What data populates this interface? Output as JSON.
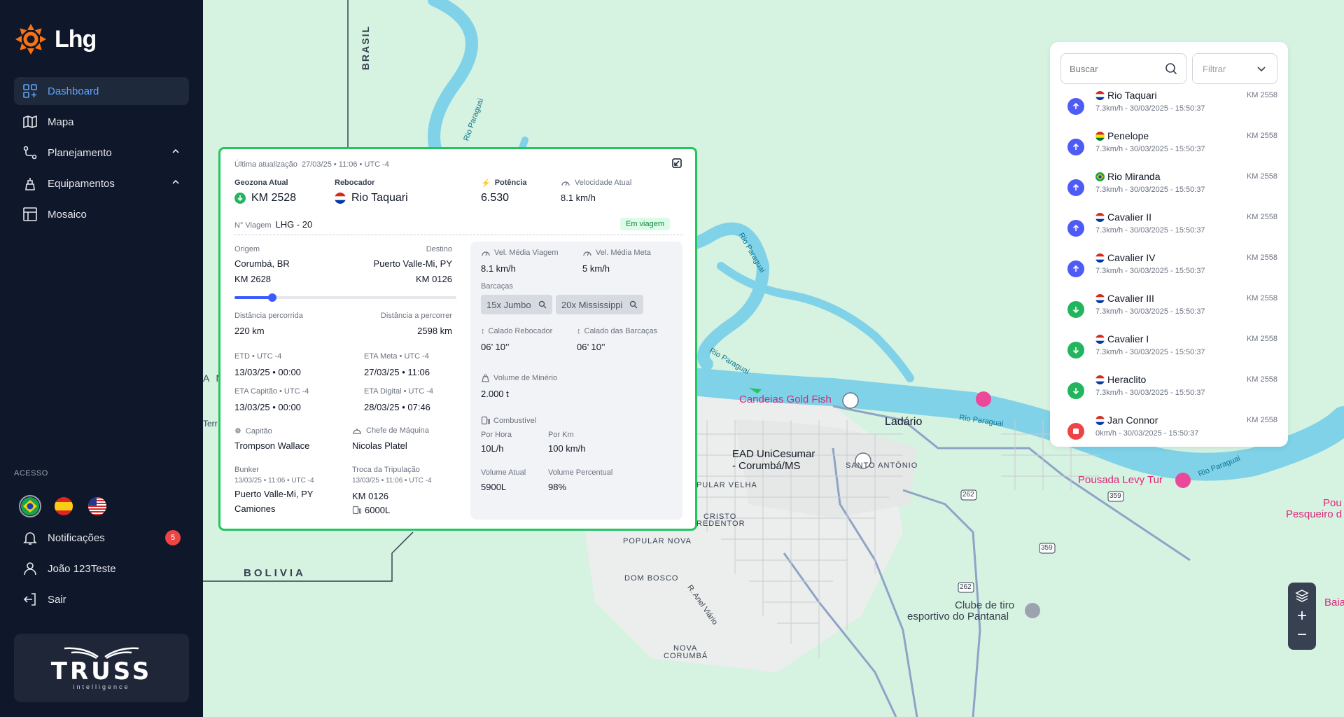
{
  "sidebar": {
    "logo_text": "Lhg",
    "nav": [
      {
        "label": "Dashboard",
        "icon": "dashboard-icon",
        "active": true
      },
      {
        "label": "Mapa",
        "icon": "map-icon"
      },
      {
        "label": "Planejamento",
        "icon": "route-icon"
      },
      {
        "label": "Equipamentos",
        "icon": "equipment-icon"
      },
      {
        "label": "Mosaico",
        "icon": "mosaic-icon"
      }
    ],
    "access_label": "ACESSO",
    "notifications_label": "Notificações",
    "notifications_count": "5",
    "user_label": "João 123Teste",
    "logout_label": "Sair",
    "brand_name": "TRUSS",
    "brand_sub": "intelligence"
  },
  "map": {
    "labels": {
      "brasil": "BRASIL",
      "bolivia": "BOLIVIA",
      "rio_paraguai": "Rio Paraguai",
      "candeias": "Candeias Gold Fish",
      "ladario": "Ladário",
      "ead_1": "EAD UniCesumar",
      "ead_2": "- Corumbá/MS",
      "santo_antonio": "SANTO ANTÔNIO",
      "popular_velha": "PULAR VELHA",
      "cristo_1": "CRISTO",
      "cristo_2": "REDENTOR",
      "popular_nova": "POPULAR NOVA",
      "dom_bosco": "DOM BOSCO",
      "anel_viario": "R. Anel Viário",
      "nova_corumba_1": "NOVA",
      "nova_corumba_2": "CORUMBÁ",
      "clube_1": "Clube de tiro",
      "clube_2": "esportivo do Pantanal",
      "pousada": "Pousada Levy Tur",
      "pesqueiro_1": "Pou",
      "pesqueiro_2": "Pesqueiro d",
      "baia": "Baia",
      "road_262": "262",
      "road_359": "359",
      "cut_an": "A N",
      "cut_terr": "Terr"
    }
  },
  "card": {
    "last_update_label": "Última atualização",
    "last_update_value": "27/03/25 • 11:06 • UTC -4",
    "geozona_label": "Geozona Atual",
    "geozona_value": "KM 2528",
    "rebocador_label": "Rebocador",
    "rebocador_value": "Rio Taquari",
    "potencia_label": "Potência",
    "potencia_value": "6.530",
    "velocidade_label": "Velocidade Atual",
    "velocidade_value": "8.1 km/h",
    "viagem_label": "N° Viagem",
    "viagem_value": "LHG - 20",
    "status": "Em viagem",
    "origem_label": "Origem",
    "origem_value": "Corumbá, BR",
    "origem_km": "KM 2628",
    "destino_label": "Destino",
    "destino_value": "Puerto Valle-Mi, PY",
    "destino_km": "KM 0126",
    "progress": 0.17,
    "dist_percorrida_label": "Distância percorrida",
    "dist_percorrida_value": "220 km",
    "dist_percorrer_label": "Distância a percorrer",
    "dist_percorrer_value": "2598 km",
    "etd_label": "ETD • UTC -4",
    "etd_value": "13/03/25 • 00:00",
    "eta_meta_label": "ETA Meta • UTC -4",
    "eta_meta_value": "27/03/25 • 11:06",
    "eta_capitao_label": "ETA Capitão • UTC -4",
    "eta_capitao_value": "13/03/25 • 00:00",
    "eta_digital_label": "ETA Digital • UTC -4",
    "eta_digital_value": "28/03/25 • 07:46",
    "capitao_label": "Capitão",
    "capitao_value": "Trompson Wallace",
    "chefe_label": "Chefe de Máquina",
    "chefe_value": "Nicolas Platel",
    "bunker_label": "Bunker",
    "bunker_date": "13/03/25 • 11:06 • UTC -4",
    "bunker_place_1": "Puerto Valle-Mi, PY",
    "bunker_place_2": "Camiones",
    "troca_label": "Troca da Tripulação",
    "troca_date": "13/03/25 • 11:06 • UTC -4",
    "troca_km": "KM 0126",
    "troca_fuel": "6000L",
    "vel_media_viagem_label": "Vel. Média Viagem",
    "vel_media_viagem_value": "8.1 km/h",
    "vel_media_meta_label": "Vel. Média Meta",
    "vel_media_meta_value": "5 km/h",
    "barcacas_label": "Barcaças",
    "barcaca_1": "15x Jumbo",
    "barcaca_2": "20x Mississippi",
    "calado_rebocador_label": "Calado Rebocador",
    "calado_rebocador_value": "06’ 10’’",
    "calado_barcacas_label": "Calado das Barcaças",
    "calado_barcacas_value": "06’ 10’’",
    "volume_minerio_label": "Volume de Minério",
    "volume_minerio_value": "2.000 t",
    "combustivel_label": "Combustível",
    "por_hora_label": "Por Hora",
    "por_hora_value": "10L/h",
    "por_km_label": "Por Km",
    "por_km_value": "100 km/h",
    "volume_atual_label": "Volume Atual",
    "volume_atual_value": "5900L",
    "volume_percentual_label": "Volume Percentual",
    "volume_percentual_value": "98%"
  },
  "list": {
    "search_placeholder": "Buscar",
    "filter_placeholder": "Filtrar",
    "vessels": [
      {
        "name": "Rio Taquari",
        "info": "7.3km/h - 30/03/2025 - 15:50:37",
        "km": "KM 2558",
        "status": "up",
        "flag": "py"
      },
      {
        "name": "Penelope",
        "info": "7.3km/h - 30/03/2025 - 15:50:37",
        "km": "KM 2558",
        "status": "up",
        "flag": "bo"
      },
      {
        "name": "Rio Miranda",
        "info": "7.3km/h - 30/03/2025 - 15:50:37",
        "km": "KM 2558",
        "status": "up",
        "flag": "br"
      },
      {
        "name": "Cavalier II",
        "info": "7.3km/h - 30/03/2025 - 15:50:37",
        "km": "KM 2558",
        "status": "up",
        "flag": "py"
      },
      {
        "name": "Cavalier IV",
        "info": "7.3km/h - 30/03/2025 - 15:50:37",
        "km": "KM 2558",
        "status": "up",
        "flag": "py"
      },
      {
        "name": "Cavalier III",
        "info": "7.3km/h - 30/03/2025 - 15:50:37",
        "km": "KM 2558",
        "status": "down",
        "flag": "py"
      },
      {
        "name": "Cavalier I",
        "info": "7.3km/h - 30/03/2025 - 15:50:37",
        "km": "KM 2558",
        "status": "down",
        "flag": "py"
      },
      {
        "name": "Heraclito",
        "info": "7.3km/h - 30/03/2025 - 15:50:37",
        "km": "KM 2558",
        "status": "down",
        "flag": "py"
      },
      {
        "name": "Jan Connor",
        "info": "0km/h - 30/03/2025 - 15:50:37",
        "km": "KM 2558",
        "status": "stopped",
        "flag": "py"
      }
    ]
  },
  "colors": {
    "accent": "#2563eb",
    "up": "#4f5bf5",
    "down": "#22b55e",
    "stopped": "#ef4444",
    "river": "#7fd2e8",
    "land": "#d6f2e1"
  }
}
